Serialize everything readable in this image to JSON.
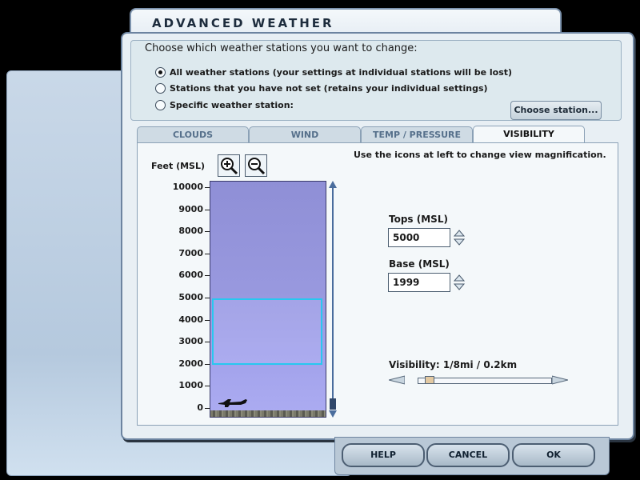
{
  "window": {
    "title": "ADVANCED WEATHER"
  },
  "stations": {
    "heading": "Choose which weather stations you want to change:",
    "options": [
      {
        "label": "All weather stations (your settings at individual stations will be lost)",
        "selected": true
      },
      {
        "label": "Stations that you have not set (retains your individual settings)",
        "selected": false
      },
      {
        "label": "Specific weather station:",
        "selected": false
      }
    ],
    "choose_button": "Choose station..."
  },
  "tabs": [
    {
      "label": "CLOUDS",
      "active": false
    },
    {
      "label": "WIND",
      "active": false
    },
    {
      "label": "TEMP / PRESSURE",
      "active": false
    },
    {
      "label": "VISIBILITY",
      "active": true
    }
  ],
  "visibility_panel": {
    "hint": "Use the icons at left to change view magnification.",
    "axis_label": "Feet (MSL)",
    "zoom_in_icon": "zoom-in-icon",
    "zoom_out_icon": "zoom-out-icon",
    "ticks": [
      "10000",
      "9000",
      "8000",
      "7000",
      "6000",
      "5000",
      "4000",
      "3000",
      "2000",
      "1000",
      "0"
    ],
    "layer": {
      "tops": 5000,
      "base": 1999
    },
    "tops_label": "Tops (MSL)",
    "tops_value": "5000",
    "base_label": "Base (MSL)",
    "base_value": "1999",
    "visibility_label": "Visibility: 1/8mi / 0.2km",
    "visibility_slider_position": 0.05,
    "aircraft_icon": "airplane-icon"
  },
  "footer": {
    "help": "HELP",
    "cancel": "CANCEL",
    "ok": "OK"
  },
  "colors": {
    "layer_border": "#28c8f0",
    "sky": "#9a9ae0"
  }
}
